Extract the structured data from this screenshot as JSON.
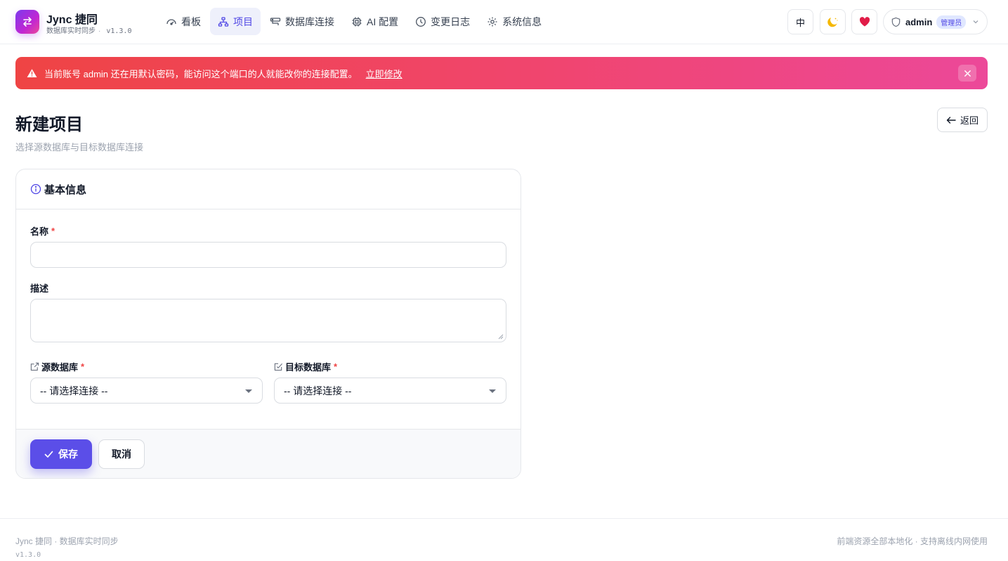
{
  "brand": {
    "title": "Jync 捷同",
    "subtitle": "数据库实时同步",
    "separator": "·",
    "version": "v1.3.0"
  },
  "nav": {
    "items": [
      {
        "label": "看板",
        "icon": "dashboard-icon",
        "active": false
      },
      {
        "label": "项目",
        "icon": "sitemap-icon",
        "active": true
      },
      {
        "label": "数据库连接",
        "icon": "database-link-icon",
        "active": false
      },
      {
        "label": "AI 配置",
        "icon": "chip-icon",
        "active": false
      },
      {
        "label": "变更日志",
        "icon": "clock-icon",
        "active": false
      },
      {
        "label": "系统信息",
        "icon": "gear-icon",
        "active": false
      }
    ]
  },
  "header_actions": {
    "language_label": "中",
    "theme_icon": "moon-icon",
    "donate_icon": "heart-icon",
    "user": {
      "name": "admin",
      "role": "管理员"
    }
  },
  "alert": {
    "message": "当前账号 admin 还在用默认密码，能访问这个端口的人就能改你的连接配置。",
    "link_label": "立即修改"
  },
  "page": {
    "title": "新建项目",
    "subtitle": "选择源数据库与目标数据库连接",
    "back_label": "返回"
  },
  "form": {
    "section_title": "基本信息",
    "name_label": "名称",
    "name_value": "",
    "description_label": "描述",
    "description_value": "",
    "required_mark": "*",
    "source_label": "源数据库",
    "source_value": "-- 请选择连接 --",
    "target_label": "目标数据库",
    "target_value": "-- 请选择连接 --",
    "save_label": "保存",
    "cancel_label": "取消"
  },
  "footer": {
    "left": "Jync 捷同 · 数据库实时同步",
    "version": "v1.3.0",
    "right": "前端资源全部本地化 · 支持离线内网使用"
  },
  "colors": {
    "accent": "#5b4ee8",
    "alert_start": "#ef4444",
    "alert_end": "#ec4899",
    "required": "#ef4444"
  }
}
